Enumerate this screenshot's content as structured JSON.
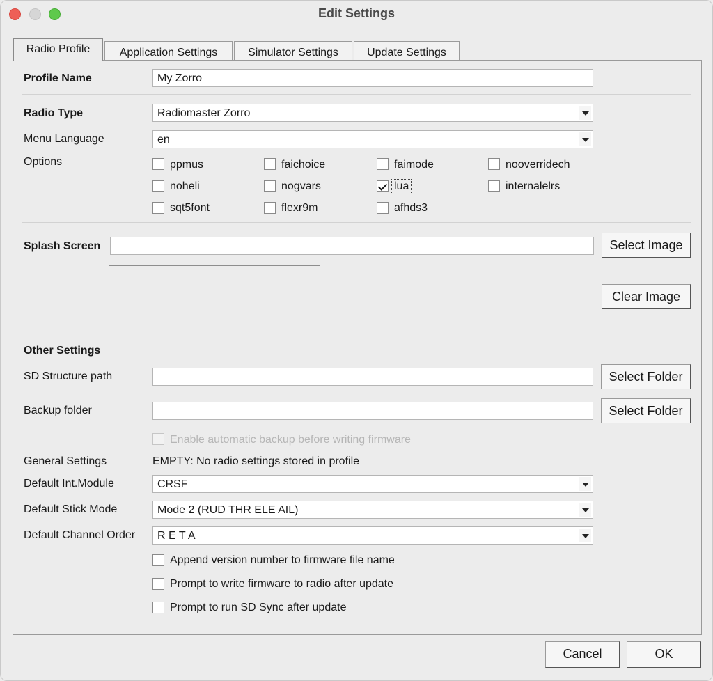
{
  "window": {
    "title": "Edit Settings"
  },
  "tabs": [
    {
      "label": "Radio Profile"
    },
    {
      "label": "Application Settings"
    },
    {
      "label": "Simulator Settings"
    },
    {
      "label": "Update Settings"
    }
  ],
  "profile": {
    "name_label": "Profile Name",
    "name_value": "My Zorro",
    "radio_type_label": "Radio Type",
    "radio_type_value": "Radiomaster Zorro",
    "menu_language_label": "Menu Language",
    "menu_language_value": "en",
    "options_label": "Options",
    "options": [
      {
        "label": "ppmus",
        "checked": false
      },
      {
        "label": "faichoice",
        "checked": false
      },
      {
        "label": "faimode",
        "checked": false
      },
      {
        "label": "nooverridech",
        "checked": false
      },
      {
        "label": "noheli",
        "checked": false
      },
      {
        "label": "nogvars",
        "checked": false
      },
      {
        "label": "lua",
        "checked": true
      },
      {
        "label": "internalelrs",
        "checked": false
      },
      {
        "label": "sqt5font",
        "checked": false
      },
      {
        "label": "flexr9m",
        "checked": false
      },
      {
        "label": "afhds3",
        "checked": false
      }
    ]
  },
  "splash": {
    "label": "Splash Screen",
    "value": "",
    "select_button": "Select Image",
    "clear_button": "Clear Image"
  },
  "other": {
    "heading": "Other Settings",
    "sd_path_label": "SD Structure path",
    "sd_path_value": "",
    "sd_select_button": "Select Folder",
    "backup_label": "Backup folder",
    "backup_value": "",
    "backup_select_button": "Select Folder",
    "auto_backup_label": "Enable automatic backup before writing firmware",
    "general_label": "General Settings",
    "general_value": "EMPTY: No radio settings stored in profile",
    "int_module_label": "Default Int.Module",
    "int_module_value": "CRSF",
    "stick_mode_label": "Default Stick Mode",
    "stick_mode_value": "Mode 2 (RUD THR ELE AIL)",
    "channel_order_label": "Default Channel Order",
    "channel_order_value": "R E T A",
    "append_version_label": "Append version number to firmware file name",
    "prompt_write_label": "Prompt to write firmware to radio after update",
    "prompt_sync_label": "Prompt to run SD Sync after update"
  },
  "footer": {
    "cancel": "Cancel",
    "ok": "OK"
  }
}
